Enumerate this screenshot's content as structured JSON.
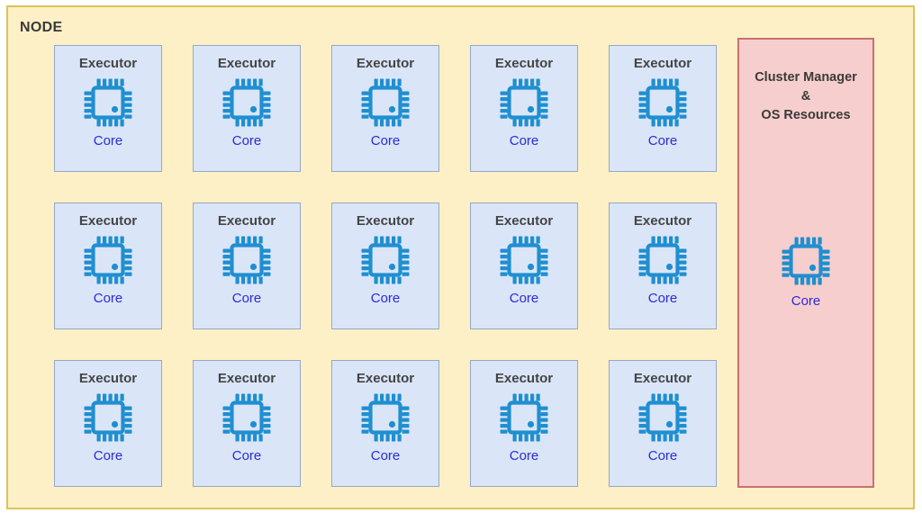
{
  "node": {
    "title": "NODE",
    "background_color": "#fdf0c6",
    "border_color": "#ddc357"
  },
  "executor_grid": {
    "rows": 3,
    "columns": 5,
    "card": {
      "title_label": "Executor",
      "core_label": "Core",
      "icon": "cpu-chip-icon",
      "background_color": "#dae5f8",
      "border_color": "#95a8c6",
      "title_color": "#444444",
      "core_color": "#2b2bd4"
    },
    "cards": [
      {
        "title": "Executor",
        "core": "Core"
      },
      {
        "title": "Executor",
        "core": "Core"
      },
      {
        "title": "Executor",
        "core": "Core"
      },
      {
        "title": "Executor",
        "core": "Core"
      },
      {
        "title": "Executor",
        "core": "Core"
      },
      {
        "title": "Executor",
        "core": "Core"
      },
      {
        "title": "Executor",
        "core": "Core"
      },
      {
        "title": "Executor",
        "core": "Core"
      },
      {
        "title": "Executor",
        "core": "Core"
      },
      {
        "title": "Executor",
        "core": "Core"
      },
      {
        "title": "Executor",
        "core": "Core"
      },
      {
        "title": "Executor",
        "core": "Core"
      },
      {
        "title": "Executor",
        "core": "Core"
      },
      {
        "title": "Executor",
        "core": "Core"
      },
      {
        "title": "Executor",
        "core": "Core"
      }
    ]
  },
  "cluster_panel": {
    "title_line1": "Cluster Manager",
    "title_line2": "&",
    "title_line3": "OS Resources",
    "core_label": "Core",
    "icon": "cpu-chip-icon",
    "background_color": "#f6cecd",
    "border_color": "#c8706f",
    "title_color": "#3a3a3a",
    "core_color": "#2b2bd4"
  },
  "icon_colors": {
    "chip_blue": "#1f8fd0",
    "chip_body_fill": "#dae5f8"
  }
}
